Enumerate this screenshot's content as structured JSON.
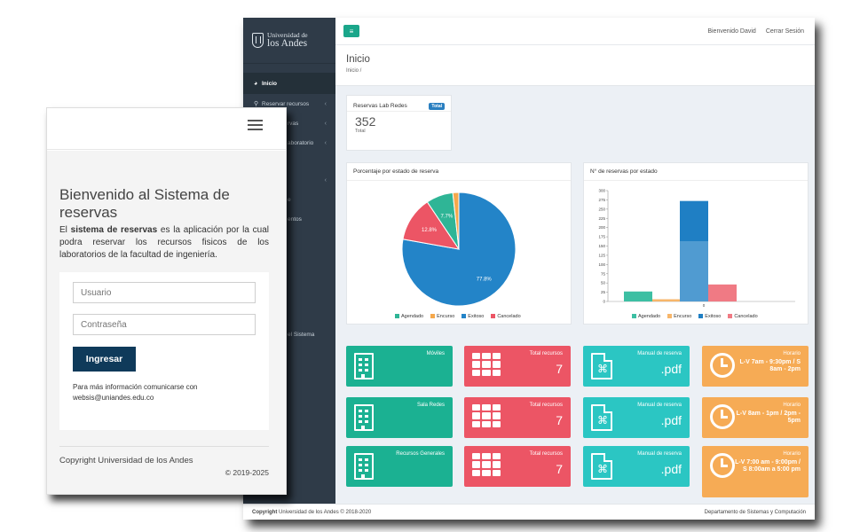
{
  "desktop": {
    "brand": {
      "line1": "Universidad de",
      "line2": "los Andes"
    },
    "nav": [
      {
        "label": "Inicio",
        "active": true,
        "icon": "dashboard-icon"
      },
      {
        "label": "Reservar recursos",
        "icon": "map-marker-icon"
      }
    ],
    "nav_partial": [
      "rvas",
      "aboratorio",
      "e",
      "entos",
      "el Sistema"
    ],
    "topbar": {
      "welcome": "Bienvenido David",
      "logout": "Cerrar Sesión"
    },
    "page": {
      "title": "Inicio",
      "breadcrumb": "Inicio  /"
    },
    "stat": {
      "title": "Reservas Lab Redes",
      "badge": "Total",
      "value": "352",
      "sub": "Total"
    },
    "pie_panel_title": "Porcentaje por estado de reserva",
    "bar_panel_title": "N° de reservas por estado",
    "tiles": [
      {
        "kind": "building",
        "label": "Móviles",
        "color": "#1bb192"
      },
      {
        "kind": "grid",
        "label": "Total recursos",
        "value": "7",
        "color": "#ec5565"
      },
      {
        "kind": "pdf",
        "label": "Manual de reserva",
        "value": ".pdf",
        "color": "#2bc6c3"
      },
      {
        "kind": "clock",
        "label": "Horario",
        "value": "L-V 7am - 9:30pm / S 8am - 2pm",
        "color": "#f6ab55"
      },
      {
        "kind": "building",
        "label": "Sala Redes",
        "color": "#1bb192"
      },
      {
        "kind": "grid",
        "label": "Total recursos",
        "value": "7",
        "color": "#ec5565"
      },
      {
        "kind": "pdf",
        "label": "Manual de reserva",
        "value": ".pdf",
        "color": "#2bc6c3"
      },
      {
        "kind": "clock",
        "label": "Horario",
        "value": "L-V 8am - 1pm / 2pm - 5pm",
        "color": "#f6ab55"
      },
      {
        "kind": "building",
        "label": "Recursos Generales",
        "color": "#1bb192"
      },
      {
        "kind": "grid",
        "label": "Total recursos",
        "value": "7",
        "color": "#ec5565"
      },
      {
        "kind": "pdf",
        "label": "Manual de reserva",
        "value": ".pdf",
        "color": "#2bc6c3"
      },
      {
        "kind": "clock",
        "label": "Horario",
        "value": "L-V 7:00 am - 9:00pm / S 8:00am a 5:00 pm",
        "color": "#f6ab55"
      }
    ],
    "footer": {
      "left_bold": "Copyright",
      "left": " Universidad de los Andes © 2018-2020",
      "right": "Departamento de Sistemas y Computación"
    }
  },
  "chart_data": [
    {
      "type": "pie",
      "categories": [
        "Agendado",
        "Encurso",
        "Exitoso",
        "Cancelado"
      ],
      "values": [
        7.7,
        1.7,
        77.8,
        12.8
      ],
      "labels": [
        "7.7%",
        "",
        "77.8%",
        "12.8%"
      ],
      "colors": [
        "#2fb596",
        "#f5a84c",
        "#2384c8",
        "#ec5565"
      ],
      "legend": "bottom"
    },
    {
      "type": "bar",
      "categories": [
        "Agendado",
        "Encurso",
        "Exitoso",
        "Cancelado"
      ],
      "values": [
        27,
        6,
        272,
        46
      ],
      "colors": [
        "#3dbfa3",
        "#f7b66a",
        "#1f7fc4",
        "#f07a84"
      ],
      "xticks": [
        "0"
      ],
      "yticks": [
        0,
        25,
        50,
        75,
        100,
        125,
        150,
        175,
        200,
        225,
        250,
        275,
        300
      ],
      "ylim": [
        0,
        300
      ],
      "legend": "bottom"
    }
  ],
  "mobile": {
    "title": "Bienvenido al Sistema de reservas",
    "desc_prefix": "El ",
    "desc_bold": "sistema de reservas",
    "desc_rest": " es la aplicación por la cual podra reservar los recursos fisicos de los laboratorios de la facultad de ingeniería.",
    "user_placeholder": "Usuario",
    "pass_placeholder": "Contraseña",
    "login": "Ingresar",
    "info_line1": "Para más información comunicarse con",
    "info_line2": "websis@uniandes.edu.co",
    "copyright": "Copyright Universidad de los Andes",
    "years": "© 2019-2025"
  }
}
